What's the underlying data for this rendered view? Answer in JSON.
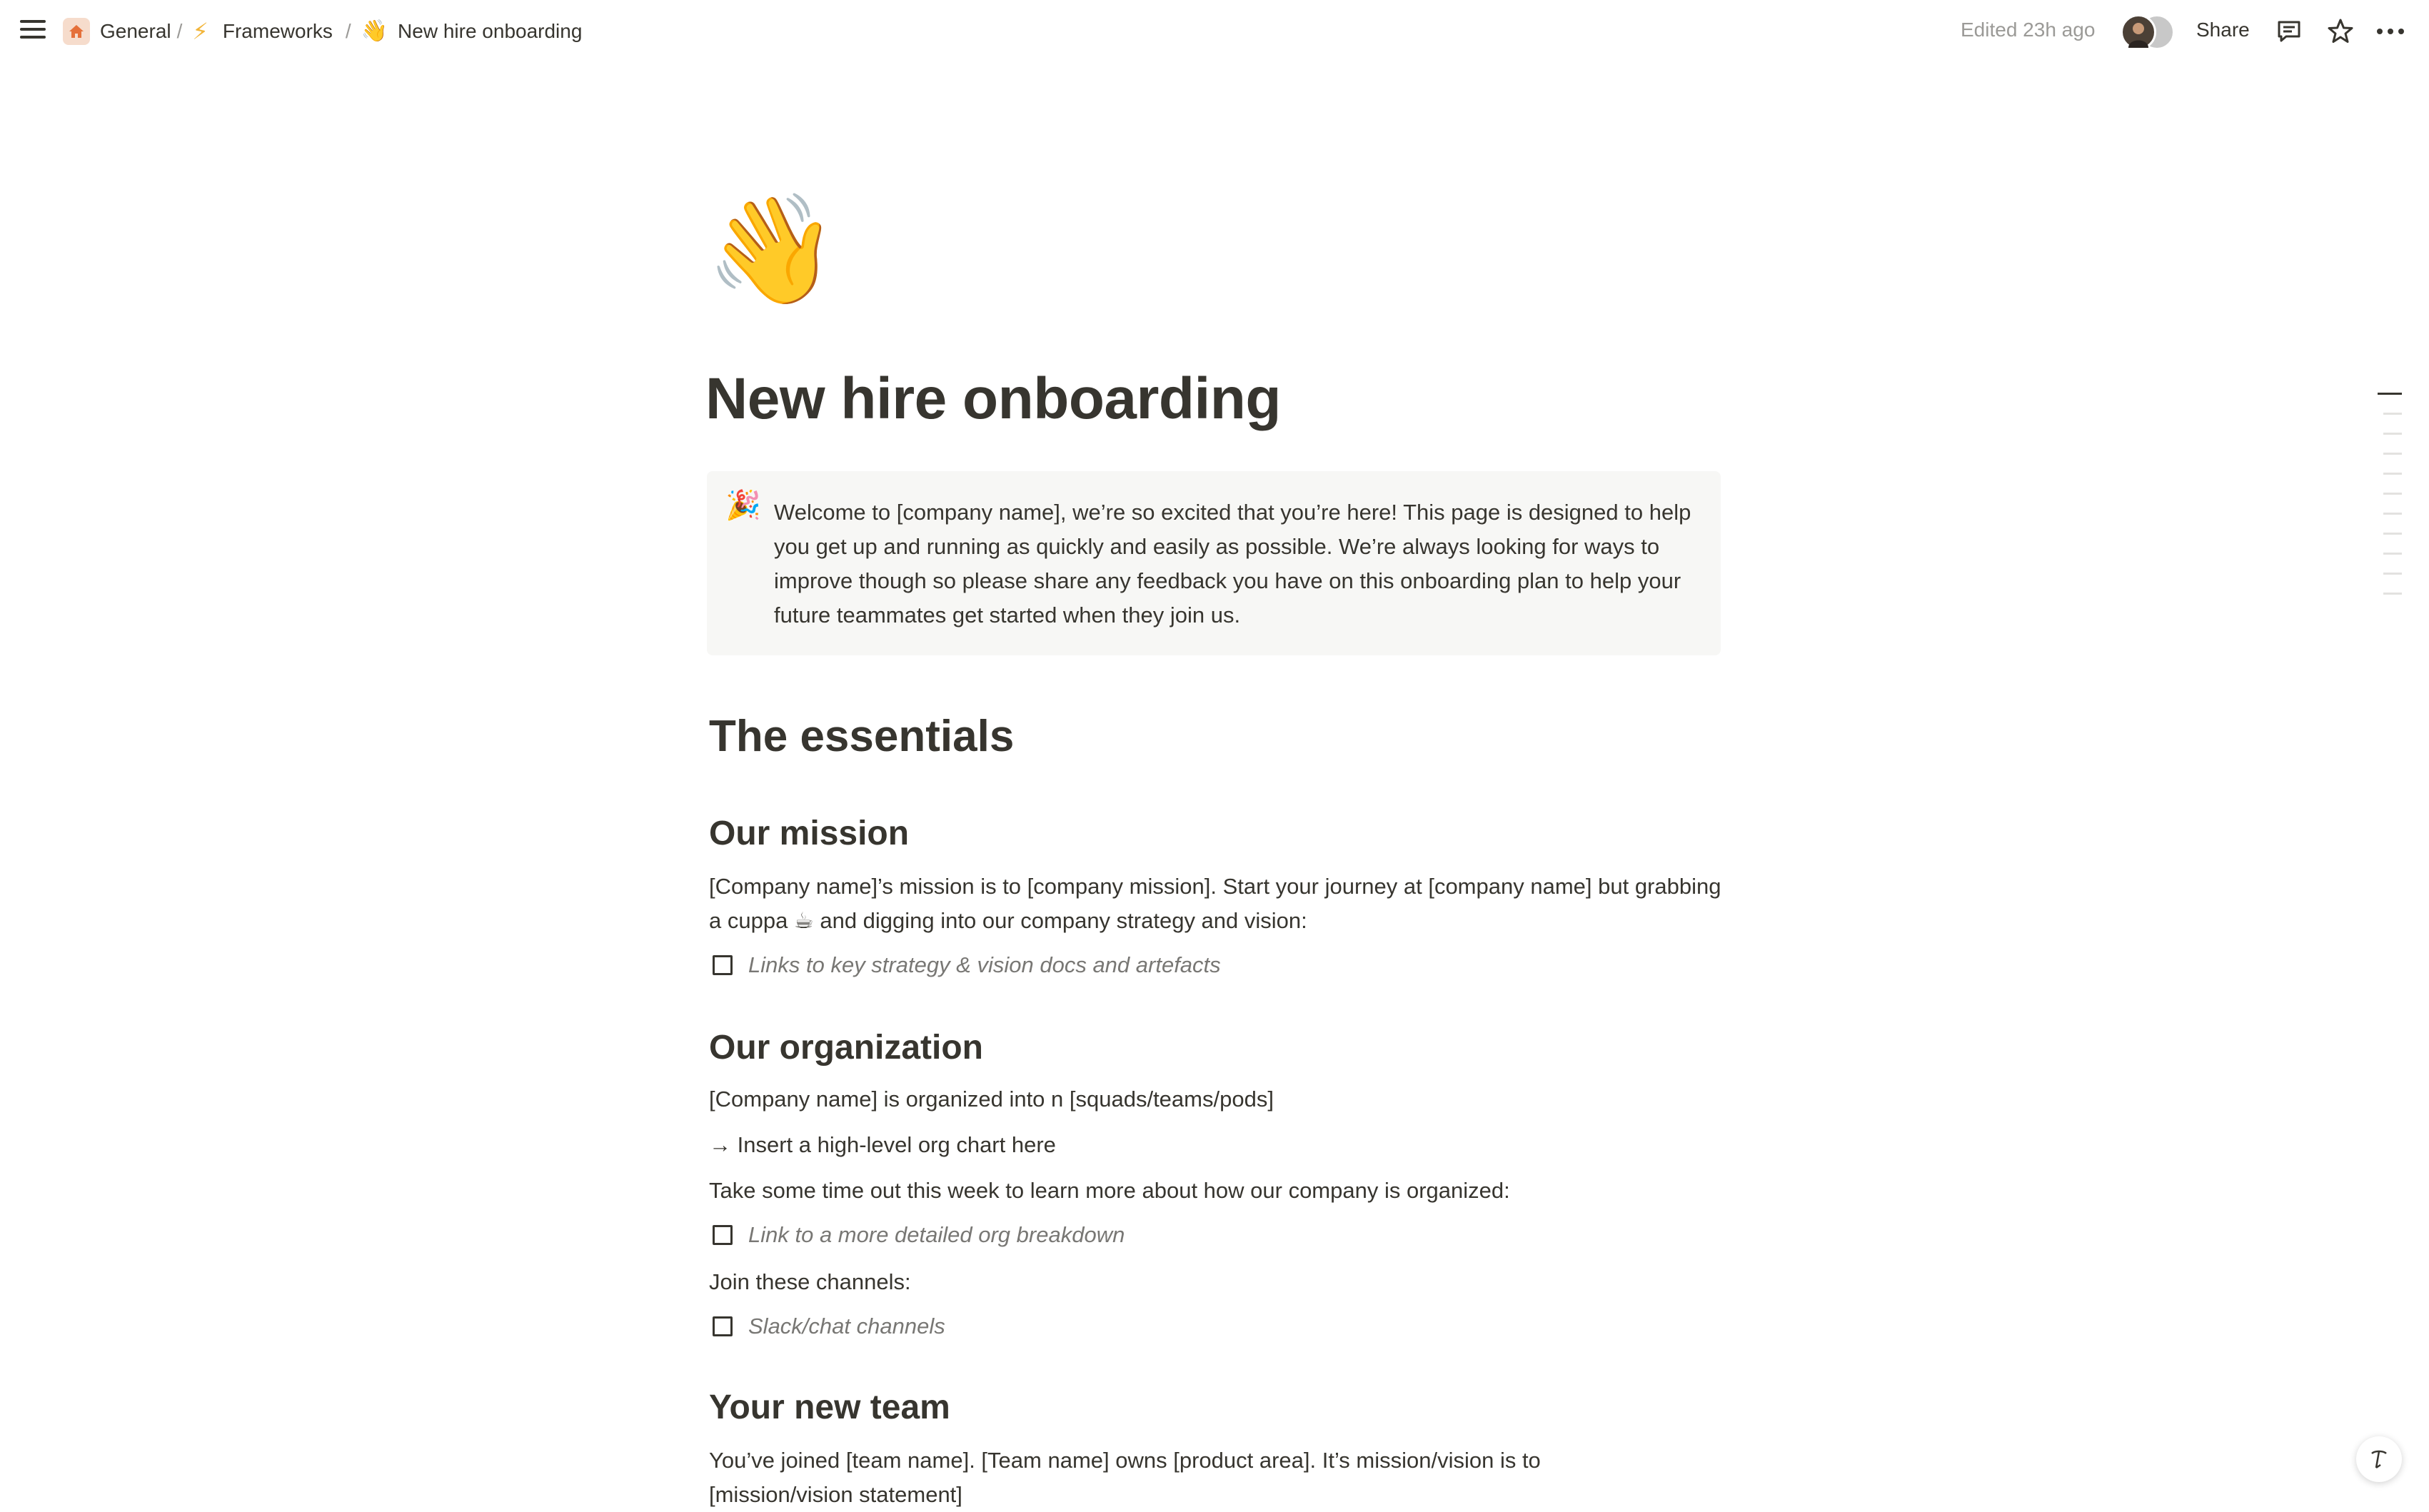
{
  "topbar": {
    "breadcrumbs": [
      {
        "icon": "home-icon",
        "label": "General"
      },
      {
        "icon": "lightning-icon",
        "label": "Frameworks"
      },
      {
        "icon": "waving-hand-emoji",
        "label": "New hire onboarding"
      }
    ],
    "separator": "/",
    "edited": "Edited 23h ago",
    "share_label": "Share",
    "icons": [
      "menu-icon",
      "comment-icon",
      "star-icon",
      "more-icon"
    ]
  },
  "page": {
    "emoji": "👋",
    "title": "New hire onboarding",
    "callout": {
      "emoji": "🎉",
      "text": "Welcome to [company name], we’re so excited that you’re here! This page is designed to help you get up and running as quickly and easily as possible. We’re always looking for ways to improve though so please share any feedback you have on this onboarding plan to help your future teammates get started when they join us."
    },
    "essentials_heading": "The essentials",
    "mission": {
      "heading": "Our mission",
      "text": "[Company name]’s mission is to [company mission]. Start your journey at [company name] but grabbing a cuppa ☕ and digging into our company strategy and vision:",
      "todo": "Links to key strategy & vision docs and artefacts"
    },
    "organization": {
      "heading": "Our organization",
      "line1": "[Company name] is organized into n [squads/teams/pods]",
      "line2": "→ Insert a high-level org chart here",
      "line3": "Take some time out this week to learn more about how our company is organized:",
      "todo1": "Link to a more detailed org breakdown",
      "line4": "Join these channels:",
      "todo2": "Slack/chat channels"
    },
    "team": {
      "heading": "Your new team",
      "text": "You’ve joined [team name]. [Team name] owns [product area]. It’s mission/vision is to [mission/vision statement]"
    }
  },
  "colors": {
    "text": "#37352f",
    "muted": "#9b9a97",
    "callout_bg": "#f7f7f5",
    "home_icon_bg": "#f6dccc",
    "bolt": "#f2b53a"
  }
}
